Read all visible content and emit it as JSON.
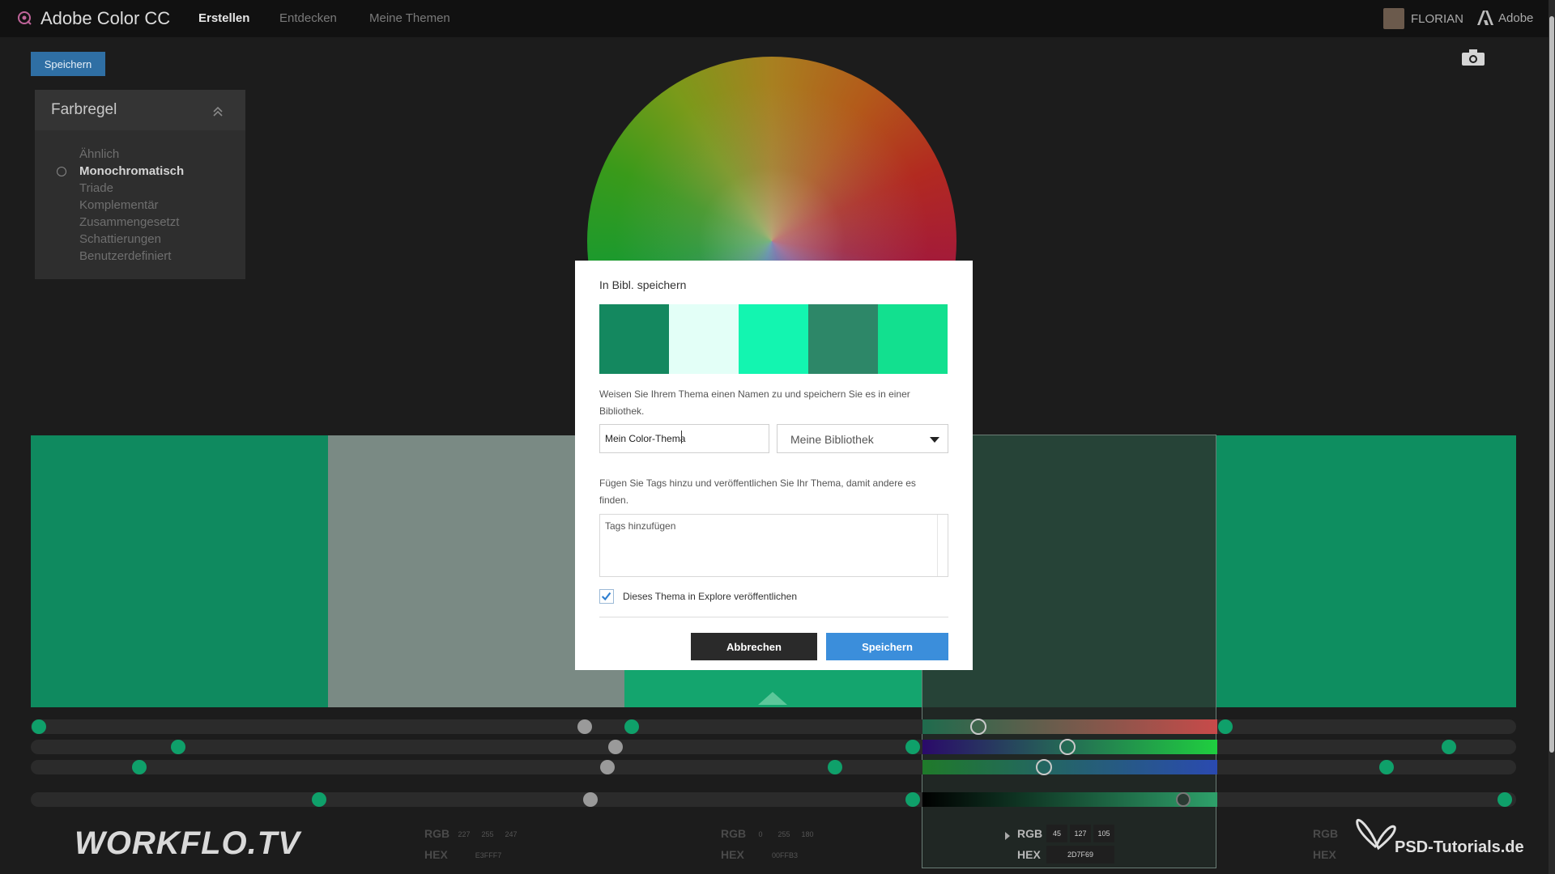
{
  "app": {
    "title": "Adobe Color CC"
  },
  "nav": {
    "tabs": [
      "Erstellen",
      "Entdecken",
      "Meine Themen"
    ],
    "active": "Erstellen"
  },
  "user": {
    "name": "FLORIAN",
    "brand": "Adobe"
  },
  "toolbar": {
    "save_label": "Speichern"
  },
  "rules": {
    "title": "Farbregel",
    "items": [
      "Ähnlich",
      "Monochromatisch",
      "Triade",
      "Komplementär",
      "Zusammengesetzt",
      "Schattierungen",
      "Benutzerdefiniert"
    ],
    "selected": "Monochromatisch"
  },
  "palette": {
    "colors": [
      "#0F8A5F",
      "#7A8A84",
      "#14A56E",
      "#2D4F40",
      "#0E8E60"
    ],
    "selected_index": 3
  },
  "swatch_info": [
    {
      "rgb_label": "RGB",
      "hex_label": "HEX",
      "rgb": [
        "227",
        "255",
        "247"
      ],
      "hex": "E3FFF7"
    },
    {
      "rgb_label": "RGB",
      "hex_label": "HEX",
      "rgb": [
        "0",
        "255",
        "180"
      ],
      "hex": "00FFB3"
    },
    {
      "rgb_label": "RGB",
      "hex_label": "HEX",
      "rgb": [
        "45",
        "127",
        "105"
      ],
      "hex": "2D7F69"
    },
    {
      "rgb_label": "RGB",
      "hex_label": "HEX"
    }
  ],
  "watermarks": {
    "left": "WORKFLO.TV",
    "right": "PSD-Tutorials.de"
  },
  "dialog": {
    "title": "In Bibl. speichern",
    "swatches": [
      "#14885F",
      "#E3FFF7",
      "#13F5B0",
      "#2D8768",
      "#12E08F"
    ],
    "name_hint": "Weisen Sie Ihrem Thema einen Namen zu und speichern Sie es in einer Bibliothek.",
    "name_value": "Mein Color-Thema",
    "library_value": "Meine Bibliothek",
    "tags_hint": "Fügen Sie Tags hinzu und veröffentlichen Sie Ihr Thema, damit andere es finden.",
    "tags_placeholder": "Tags hinzufügen",
    "publish_label": "Dieses Thema in Explore veröffentlichen",
    "publish_checked": true,
    "cancel_label": "Abbrechen",
    "save_label": "Speichern"
  },
  "icons": {
    "logo": "adobe-color-icon",
    "camera": "camera-icon",
    "collapse": "chevron-up-double-icon",
    "dropdown": "caret-down-icon",
    "checkbox": "checkmark-icon"
  }
}
